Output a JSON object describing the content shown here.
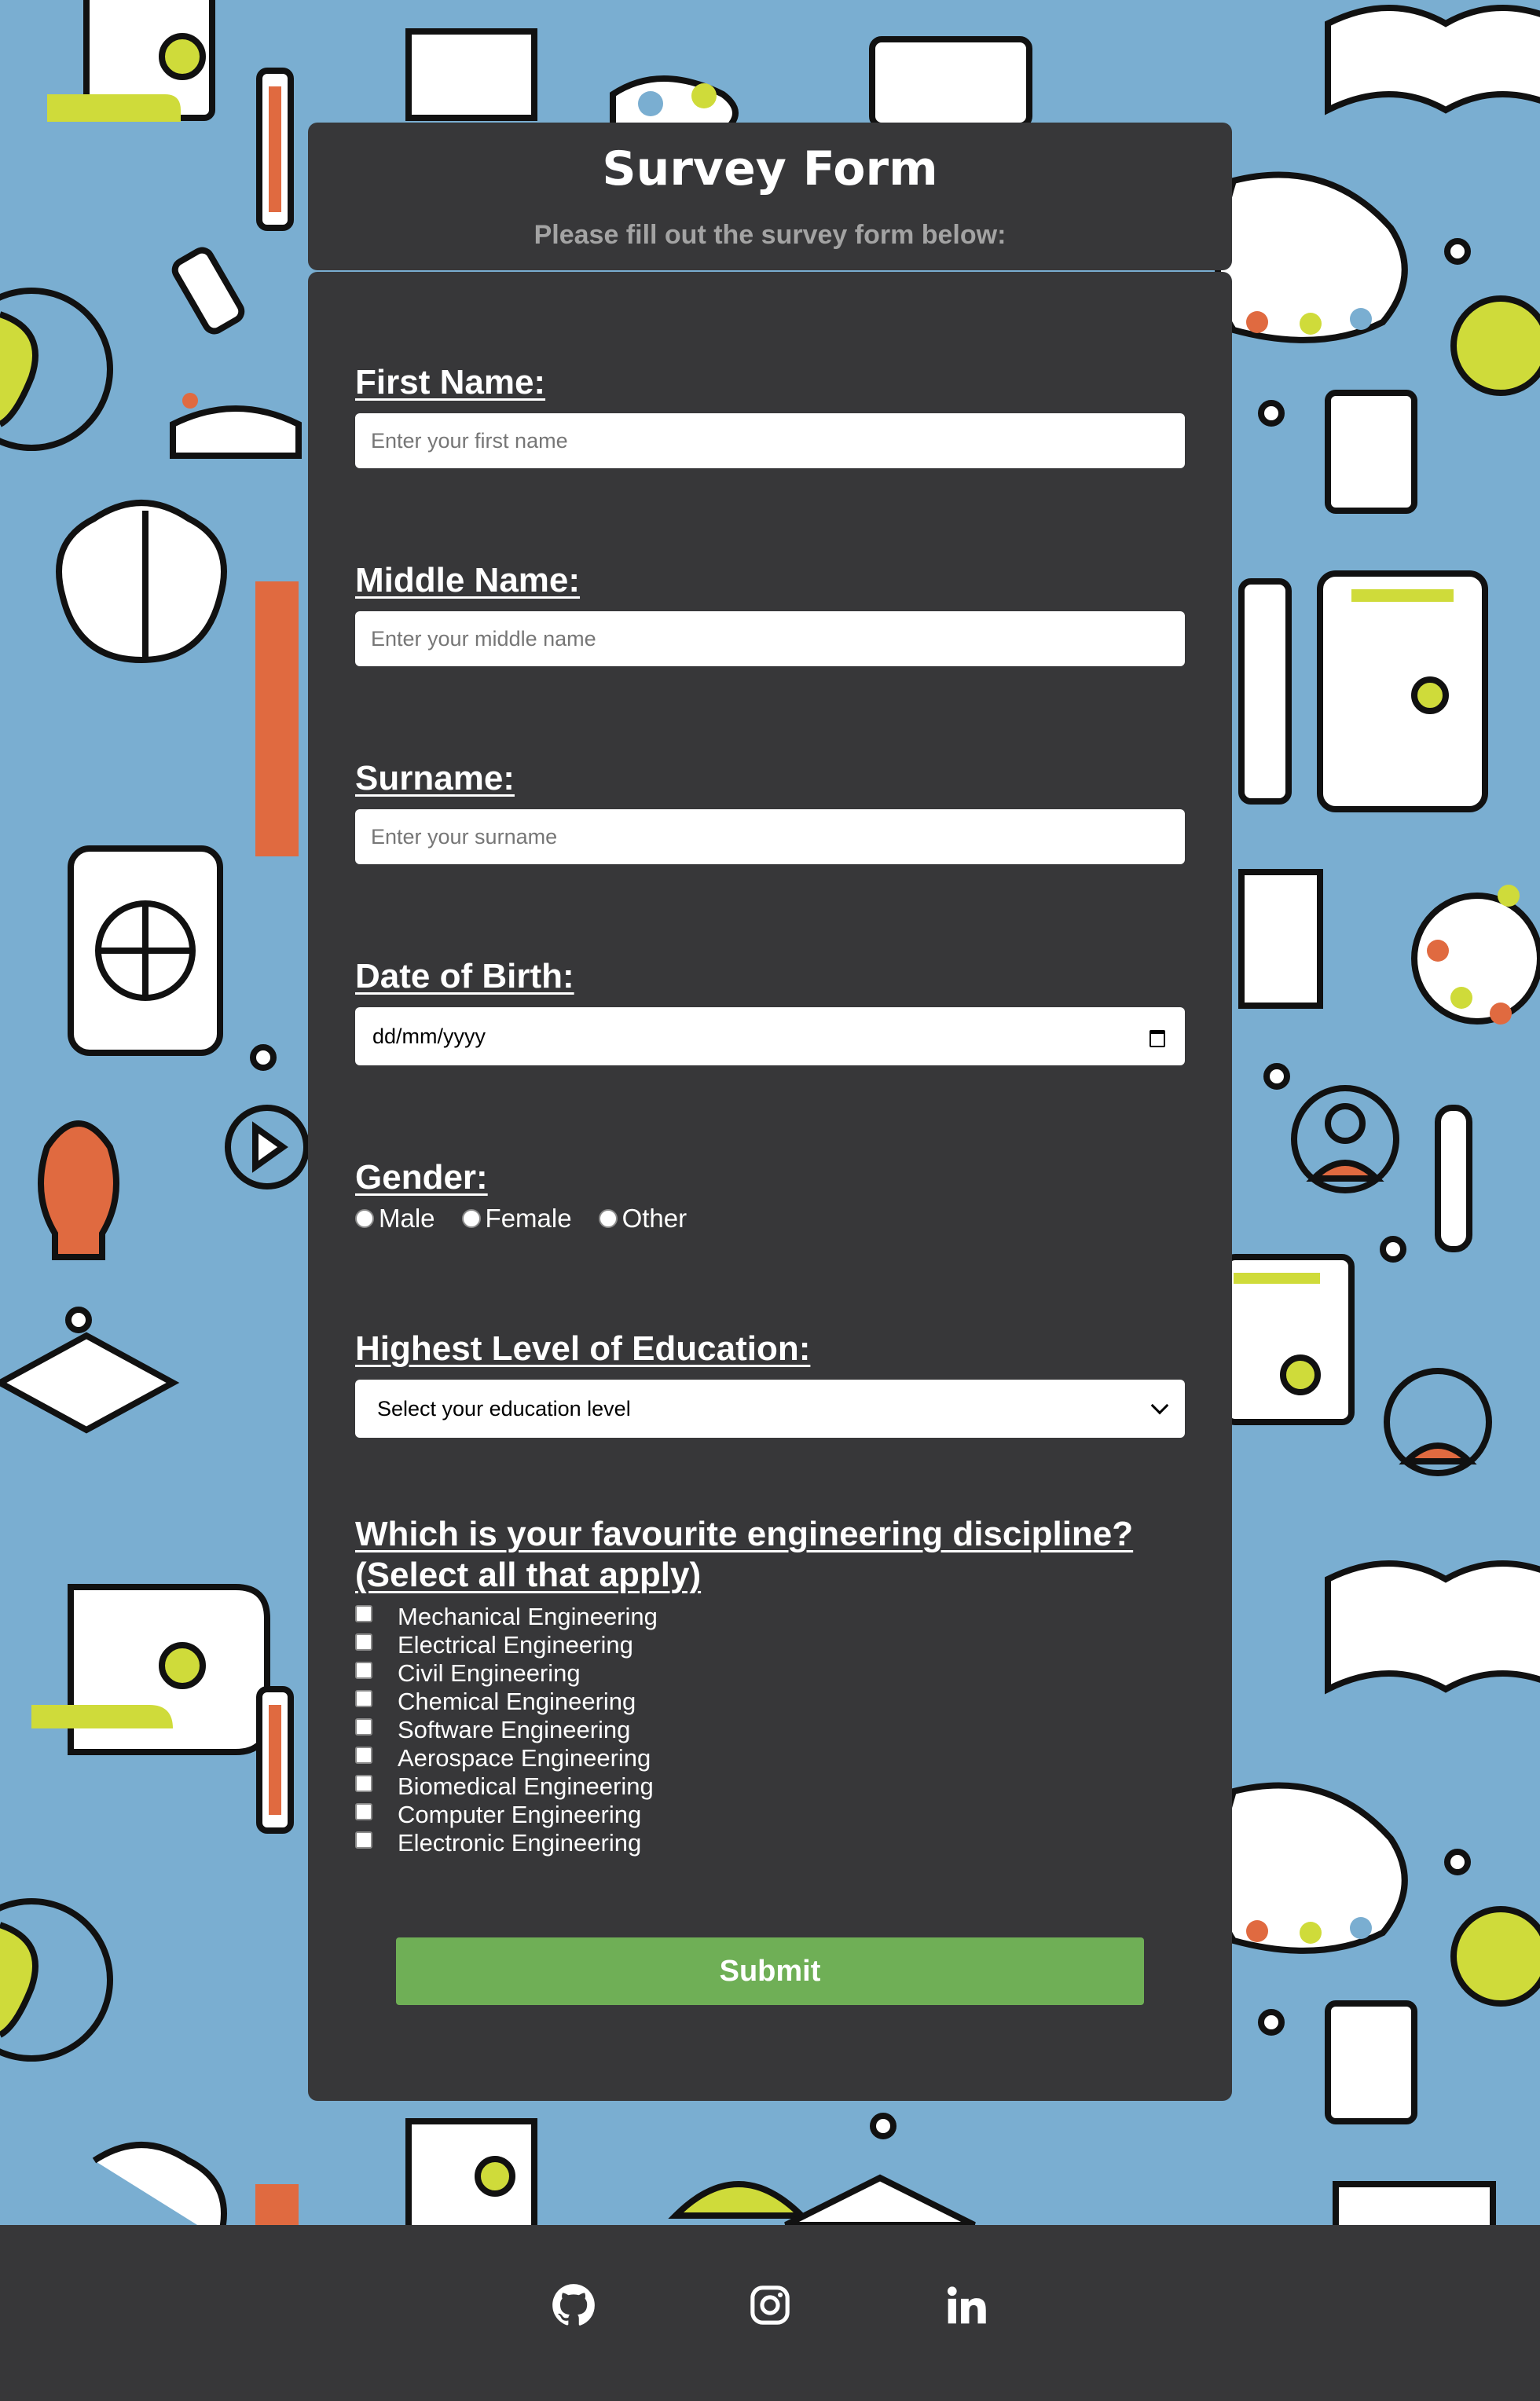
{
  "header": {
    "title": "Survey Form",
    "subtitle": "Please fill out the survey form below:"
  },
  "fields": {
    "first_name": {
      "label": "First Name:",
      "placeholder": "Enter your first name",
      "value": ""
    },
    "middle_name": {
      "label": "Middle Name:",
      "placeholder": "Enter your middle name",
      "value": ""
    },
    "surname": {
      "label": "Surname:",
      "placeholder": "Enter your surname",
      "value": ""
    },
    "dob": {
      "label": "Date of Birth:",
      "value": "dd/mm/yyyy"
    },
    "gender": {
      "label": "Gender:",
      "options": [
        "Male",
        "Female",
        "Other"
      ]
    },
    "education": {
      "label": "Highest Level of Education:",
      "selected": "Select your education level"
    },
    "discipline": {
      "label_line1": "Which is your favourite engineering discipline?",
      "label_line2": "(Select all that apply)",
      "options": [
        "Mechanical Engineering",
        "Electrical Engineering",
        "Civil Engineering",
        "Chemical Engineering",
        "Software Engineering",
        "Aerospace Engineering",
        "Biomedical Engineering",
        "Computer Engineering",
        "Electronic Engineering"
      ]
    }
  },
  "submit_label": "Submit",
  "footer": {
    "icons": [
      "github-icon",
      "instagram-icon",
      "linkedin-icon"
    ]
  },
  "colors": {
    "page_background": "#7aaed1",
    "card": "#373739",
    "submit": "#6faf56",
    "footer": "#373739"
  }
}
